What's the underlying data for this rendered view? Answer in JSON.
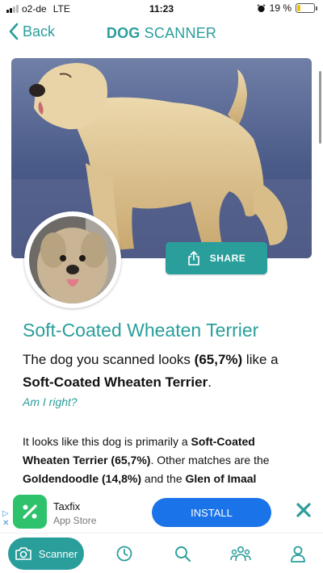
{
  "status_bar": {
    "carrier": "o2-de",
    "network": "LTE",
    "time": "11:23",
    "battery_percent": "19 %",
    "battery_level": 0.19,
    "signal_bars_active": 2,
    "battery_color": "#f4c300"
  },
  "nav": {
    "back_label": "Back",
    "title_bold": "DOG",
    "title_rest": " SCANNER"
  },
  "hero": {
    "share_label": "SHARE",
    "share_icon": "share-icon"
  },
  "result": {
    "breed": "Soft-Coated Wheaten Terrier",
    "sentence_start": "The dog you scanned looks ",
    "percent": "(65,7%)",
    "sentence_mid": " like a",
    "breed_bold": "Soft-Coated Wheaten Terrier",
    "sentence_end": ".",
    "feedback_link": "Am I right?"
  },
  "detail": {
    "lead": "It looks like this dog is primarily a ",
    "primary": "Soft-Coated Wheaten Terrier (65,7%)",
    "mid": ". Other matches are the ",
    "second": "Goldendoodle (14,8%)",
    "and": " and the ",
    "third": "Glen of Imaal"
  },
  "ad": {
    "app_name": "Taxfix",
    "store": "App Store",
    "install_label": "INSTALL",
    "info_marker": "▷",
    "close_marker": "✕"
  },
  "tabs": {
    "active_label": "Scanner",
    "items": [
      "scanner",
      "history",
      "search",
      "community",
      "profile"
    ]
  },
  "colors": {
    "accent": "#2a9e9b",
    "install_blue": "#1a73e8",
    "ad_icon_green": "#2dc26b"
  }
}
